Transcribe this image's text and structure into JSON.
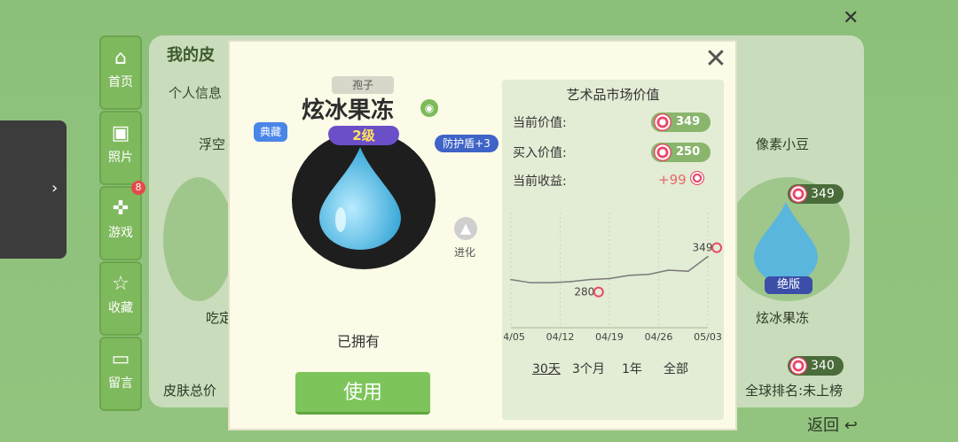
{
  "background": {
    "panel_title": "我的皮",
    "subtitle": "个人信息",
    "sidebar": [
      {
        "label": "首页",
        "icon": "home-icon"
      },
      {
        "label": "照片",
        "icon": "photo-icon"
      },
      {
        "label": "游戏",
        "icon": "gamepad-icon",
        "badge": "8"
      },
      {
        "label": "收藏",
        "icon": "star-icon"
      },
      {
        "label": "留言",
        "icon": "message-icon"
      }
    ],
    "skins": [
      {
        "label": "浮空"
      },
      {
        "label": "吃定"
      },
      {
        "label": "像素小豆"
      },
      {
        "label": "炫冰果冻",
        "price": "349",
        "tag": "绝版"
      }
    ],
    "lower_price": "340",
    "total_label": "皮肤总价",
    "rank_label": "全球排名:未上榜",
    "back_label": "返回"
  },
  "modal": {
    "category": "孢子",
    "skin_name": "炫冰果冻",
    "classic_badge": "典藏",
    "level": "2级",
    "shield": "防护盾+3",
    "evolve": "进化",
    "owned": "已拥有",
    "use_button": "使用",
    "market": {
      "title": "艺术品市场价值",
      "current_label": "当前价值:",
      "current_value": "349",
      "buy_label": "买入价值:",
      "buy_value": "250",
      "profit_label": "当前收益:",
      "profit_value": "+99",
      "periods": [
        "30天",
        "3个月",
        "1年",
        "全部"
      ]
    }
  },
  "chart_data": {
    "type": "line",
    "x": [
      "04/05",
      "04/08",
      "04/11",
      "04/14",
      "04/17",
      "04/20",
      "04/23",
      "04/26",
      "04/29",
      "05/01",
      "05/03"
    ],
    "values": [
      296,
      293,
      293,
      294,
      296,
      297,
      300,
      301,
      305,
      304,
      318
    ],
    "xticks": [
      "04/05",
      "04/12",
      "04/19",
      "04/26",
      "05/03"
    ],
    "annotations": [
      {
        "x": "04/17",
        "label": "280"
      },
      {
        "x": "05/03",
        "label": "349"
      }
    ],
    "accent": "#7a7a7a"
  },
  "colors": {
    "accent_green": "#7dc55a",
    "candy_red": "#e84a6a"
  }
}
